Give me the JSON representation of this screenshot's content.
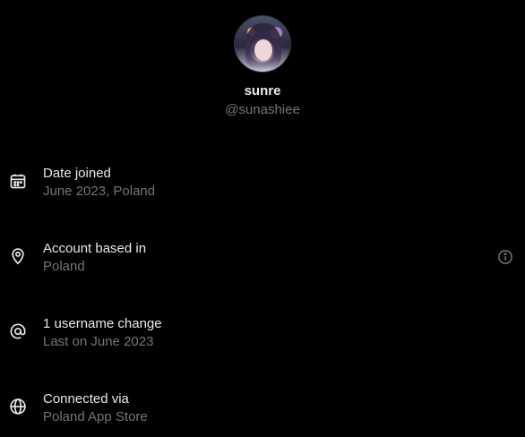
{
  "profile": {
    "display_name": "sunre",
    "handle": "@sunashiee"
  },
  "details": [
    {
      "icon": "calendar-icon",
      "title": "Date joined",
      "value": "June 2023, Poland"
    },
    {
      "icon": "location-pin-icon",
      "title": "Account based in",
      "value": "Poland",
      "has_info": true
    },
    {
      "icon": "at-sign-icon",
      "title": "1 username change",
      "value": "Last on June 2023"
    },
    {
      "icon": "globe-icon",
      "title": "Connected via",
      "value": "Poland App Store"
    }
  ],
  "colors": {
    "background": "#000000",
    "primary_text": "#e7e9ea",
    "secondary_text": "#71767b"
  }
}
